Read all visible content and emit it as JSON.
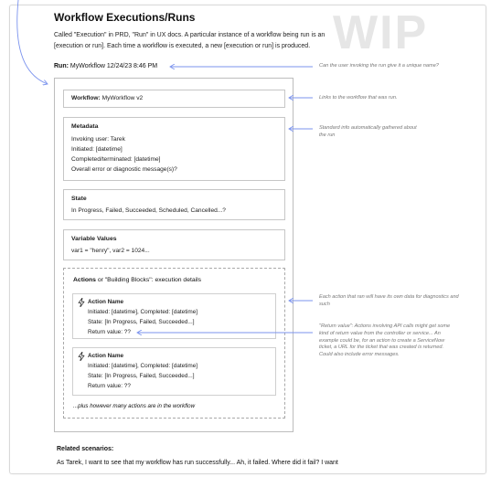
{
  "watermark": "WIP",
  "title": "Workflow Executions/Runs",
  "intro": "Called \"Execution\" in PRD, \"Run\" in UX docs. A particular instance of a workflow being run is an [execution or run]. Each time a workflow is executed, a new [execution or run] is produced.",
  "run": {
    "label": "Run:",
    "value": "MyWorkflow 12/24/23 8:46 PM"
  },
  "workflow": {
    "label": "Workflow:",
    "value": "MyWorkflow v2"
  },
  "metadata": {
    "heading": "Metadata",
    "lines": [
      "Invoking user: Tarek",
      "Initiated: [datetime]",
      "Completed/terminated: [datetime]",
      "Overall error or diagnostic message(s)?"
    ]
  },
  "state": {
    "heading": "State",
    "text": "In Progress, Failed, Succeeded, Scheduled, Cancelled...?"
  },
  "variables": {
    "heading": "Variable Values",
    "text": "var1 = \"henry\",  var2 = 1024..."
  },
  "actions": {
    "heading_bold": "Actions",
    "heading_rest": " or \"Building Blocks\": execution details",
    "items": [
      {
        "name": "Action Name",
        "initiated": "Initiated: [datetime], Completed: [datetime]",
        "state": "State: [In Progress, Failed, Succeeded...]",
        "return_value": "Return value: ??"
      },
      {
        "name": "Action Name",
        "initiated": "Initiated: [datetime], Completed: [datetime]",
        "state": "State: [In Progress, Failed, Succeeded...]",
        "return_value": "Return value: ??"
      }
    ],
    "more": "...plus however many actions are in the workflow"
  },
  "notes": {
    "run_name": "Can the user invoking the run give it a unique name?",
    "workflow_link": "Links to the workflow that was run.",
    "metadata": "Standard info automatically gathered about the run",
    "actions": "Each action that ran will have its own data for diagnostics and such",
    "return_value": "\"Return value\": Actions involving API calls might get some kind of return value from the controller or service... An example could be, for an action to create a ServiceNow ticket, a URL for the ticket that was created is returned. Could also include error messages."
  },
  "related": {
    "heading": "Related scenarios:",
    "text": "As Tarek, I want to see that my workflow has run successfully... Ah, it failed. Where did it fail? I want"
  },
  "colors": {
    "connector": "#7b93ee",
    "watermark": "#e6e6e6",
    "note_text": "#777777",
    "box_border": "#c6c6c6"
  }
}
